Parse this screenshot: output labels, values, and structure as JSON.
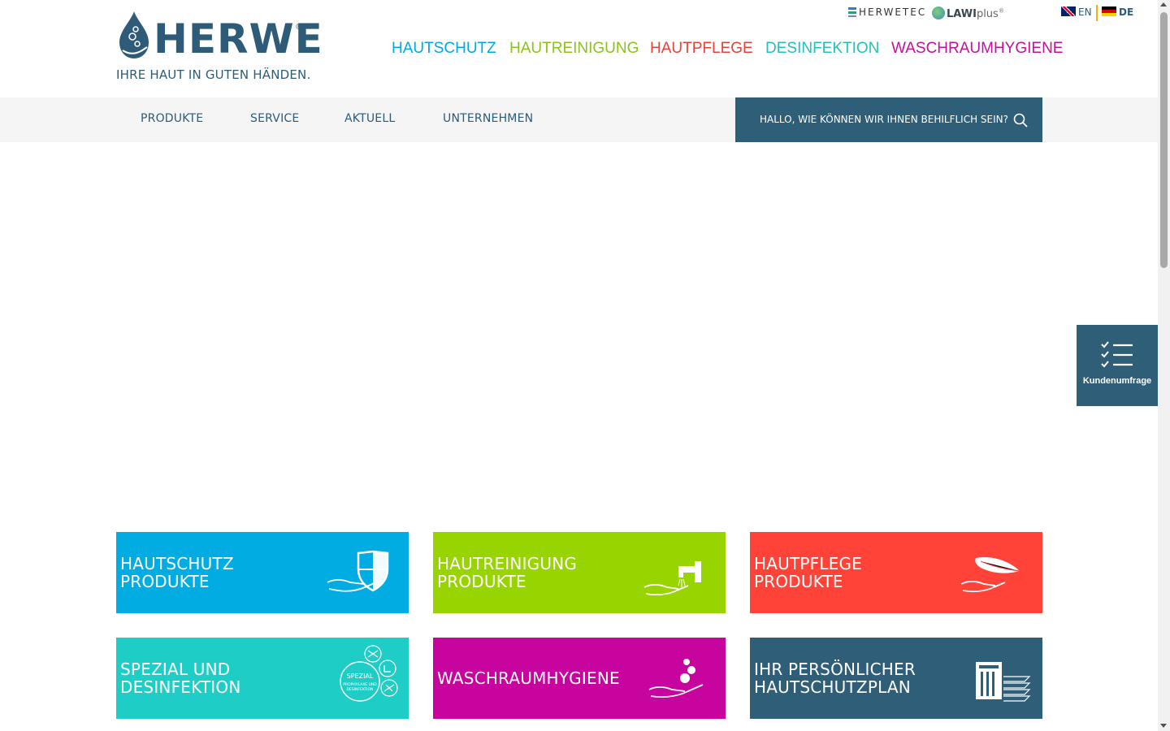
{
  "logo": {
    "wordmark": "HERWE",
    "registered": "®",
    "tagline": "IHRE HAUT IN GUTEN HÄNDEN."
  },
  "brands": {
    "herwetec": "HERWETEC",
    "lawi_bold": "LAWI",
    "lawi_rest": "plus",
    "lawi_tm": "®"
  },
  "language": {
    "en": "EN",
    "de": "DE",
    "active": "DE"
  },
  "category_nav": [
    {
      "label": "HAUTSCHUTZ",
      "color": "#00a9e0"
    },
    {
      "label": "HAUTREINIGUNG",
      "color": "#8dc21f"
    },
    {
      "label": "HAUTPFLEGE",
      "color": "#e8423a"
    },
    {
      "label": "DESINFEKTION",
      "color": "#24c0b8"
    },
    {
      "label": "WASCHRAUMHYGIENE",
      "color": "#c4119a"
    }
  ],
  "main_nav": [
    "PRODUKTE",
    "SERVICE",
    "AKTUELL",
    "UNTERNEHMEN"
  ],
  "search": {
    "placeholder": "HALLO, WIE KÖNNEN WIR IHNEN BEHILFLICH SEIN?"
  },
  "tiles": [
    {
      "label": "HAUTSCHUTZ\nPRODUKTE",
      "color": "#00ace2",
      "icon": "shield-hand-icon"
    },
    {
      "label": "HAUTREINIGUNG\nPRODUKTE",
      "color": "#97d400",
      "icon": "faucet-hand-icon"
    },
    {
      "label": "HAUTPFLEGE\nPRODUKTE",
      "color": "#ff4338",
      "icon": "feather-hand-icon"
    },
    {
      "label": "SPEZIAL UND\nDESINFEKTION",
      "color": "#1ecec6",
      "icon": "special-disinfection-icon",
      "icon_text_1": "SPEZIAL",
      "icon_text_2": "PROPHYLAXE UND",
      "icon_text_3": "DESINFEKTION"
    },
    {
      "label": "WASCHRAUMHYGIENE",
      "color": "#c8049e",
      "icon": "bubbles-hand-icon"
    },
    {
      "label": "IHR PERSÖNLICHER\nHAUTSCHUTZPLAN",
      "color": "#2e5e78",
      "icon": "document-stack-icon"
    }
  ],
  "survey": {
    "label": "Kundenumfrage",
    "icon": "checklist-icon"
  }
}
